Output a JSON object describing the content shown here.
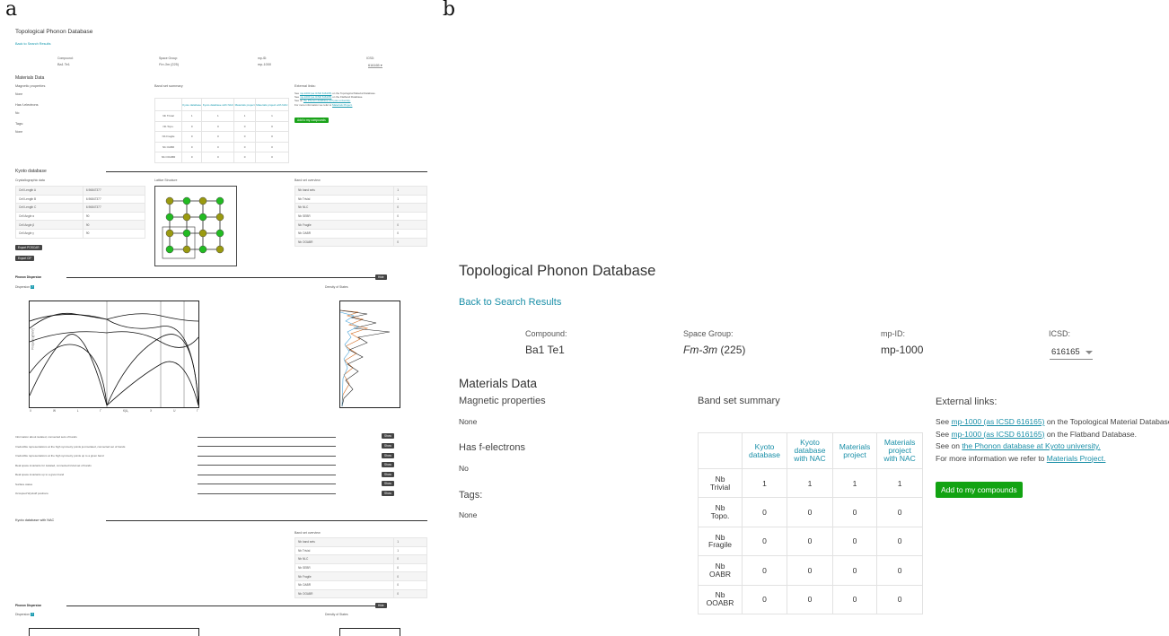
{
  "panel_labels": {
    "a": "a",
    "b": "b"
  },
  "colors": {
    "accent_link": "#1a8fa8",
    "button_green": "#12a312",
    "button_dark": "#444444",
    "atom_green": "#22bb22",
    "atom_olive": "#9a9a10"
  },
  "page": {
    "title": "Topological Phonon Database",
    "back_link": "Back to Search Results",
    "header": {
      "compound_label": "Compound:",
      "compound_value": "Ba1 Te1",
      "space_group_label": "Space Group:",
      "space_group_value": "Fm-3m",
      "space_group_number": "(225)",
      "mpid_label": "mp-ID:",
      "mpid_value": "mp-1000",
      "icsd_label": "ICSD:",
      "icsd_selected": "616165"
    },
    "materials_data": {
      "heading": "Materials Data",
      "magnetic_label": "Magnetic properties",
      "magnetic_value": "None",
      "f_electrons_label": "Has f-electrons",
      "f_electrons_value": "No",
      "tags_label": "Tags:",
      "tags_value": "None"
    },
    "band_summary": {
      "heading": "Band set summary",
      "columns": [
        "Kyoto database",
        "Kyoto database with NAC",
        "Materials project",
        "Materials project with NAC"
      ],
      "columns_b": [
        [
          "Kyoto",
          "database"
        ],
        [
          "Kyoto",
          "database",
          "with NAC"
        ],
        [
          "Materials",
          "project"
        ],
        [
          "Materials",
          "project",
          "with NAC"
        ]
      ],
      "rows_a": [
        "Nb Trivial",
        "Nb Topo.",
        "Nb Fragile",
        "Nb OABR",
        "Nb OOABR"
      ],
      "rows_b": [
        [
          "Nb",
          "Trivial"
        ],
        [
          "Nb",
          "Topo."
        ],
        [
          "Nb",
          "Fragile"
        ],
        [
          "Nb",
          "OABR"
        ],
        [
          "Nb",
          "OOABR"
        ]
      ],
      "values": [
        [
          "1",
          "1",
          "1",
          "1"
        ],
        [
          "0",
          "0",
          "0",
          "0"
        ],
        [
          "0",
          "0",
          "0",
          "0"
        ],
        [
          "0",
          "0",
          "0",
          "0"
        ],
        [
          "0",
          "0",
          "0",
          "0"
        ]
      ]
    },
    "external_links": {
      "heading": "External links:",
      "line1_prefix": "See ",
      "line1_link": "mp-1000 (as ICSD 616165)",
      "line1_suffix": " on the Topological Material Database.",
      "line2_prefix": "See ",
      "line2_link": "mp-1000 (as ICSD 616165)",
      "line2_suffix": " on the Flatband Database.",
      "line3_prefix": "See on ",
      "line3_link": "the Phonon database at Kyoto university.",
      "line4_prefix": "For more information we refer to ",
      "line4_link": "Materials Project."
    },
    "add_button": "Add to my compounds"
  },
  "kyoto": {
    "heading": "Kyoto database",
    "cryst_heading": "Crystallographic data",
    "cryst_rows": [
      [
        "Cell Length A",
        "6.96847377"
      ],
      [
        "Cell Length B",
        "6.96847377"
      ],
      [
        "Cell Length C",
        "6.96847377"
      ],
      [
        "Cell Angle α",
        "90"
      ],
      [
        "Cell Angle β",
        "90"
      ],
      [
        "Cell Angle γ",
        "90"
      ]
    ],
    "export_poscar": "Export POSCAR",
    "export_cif": "Export CIF",
    "lattice_heading": "Lattice Structure",
    "overview_heading": "Band set overview",
    "overview_rows": [
      [
        "Nb band sets",
        "1"
      ],
      [
        "Nb Trivial",
        "1"
      ],
      [
        "Nb NLC",
        "0"
      ],
      [
        "Nb SEBR",
        "0"
      ],
      [
        "Nb Fragile",
        "0"
      ],
      [
        "Nb OABR",
        "0"
      ],
      [
        "Nb OOABR",
        "0"
      ]
    ],
    "phonon_heading": "Phonon Dispersion",
    "hide": "Hide",
    "dispersion_label": "Dispersion",
    "dos_label": "Density of States",
    "ylabel": "Frequency[meV]",
    "y_ticks": [
      "0",
      "2",
      "4",
      "6",
      "8",
      "10",
      "12",
      "14"
    ],
    "k_labels": [
      "Γ",
      "X",
      "W",
      "L",
      "Γ",
      "K|U₁",
      "X",
      "U",
      "Γ"
    ],
    "k_labels_a": [
      "X",
      "W",
      "L",
      "Γ",
      "K|U₁",
      "X",
      "U",
      "Γ"
    ],
    "dos_x_ticks": [
      "0",
      "0.5",
      "1",
      "1.5"
    ],
    "dos_legend": [
      "Ba",
      "Te",
      "Σ"
    ],
    "info_rows": [
      "Information about isolated, connected sets of bands",
      "Irreducible representations at the high symmetry points just isolated, connected set of bands",
      "Irreducible representations at the high symmetry points up to a given band",
      "Real space invariants for isolated, connected trivial set of bands",
      "Real space invariants up to a given band",
      "Surface states",
      "Occupied Wyckoff positions"
    ],
    "show": "Show"
  },
  "kyoto_nac": {
    "heading": "Kyoto database with NAC",
    "overview_heading": "Band set overview",
    "overview_rows": [
      [
        "Nb band sets",
        "1"
      ],
      [
        "Nb Trivial",
        "1"
      ],
      [
        "Nb NLC",
        "0"
      ],
      [
        "Nb SEBR",
        "0"
      ],
      [
        "Nb Fragile",
        "0"
      ],
      [
        "Nb OABR",
        "0"
      ],
      [
        "Nb OOABR",
        "0"
      ]
    ],
    "phonon_heading": "Phonon Dispersion",
    "hide": "Hide",
    "dispersion_label": "Dispersion",
    "dos_label": "Density of States"
  }
}
